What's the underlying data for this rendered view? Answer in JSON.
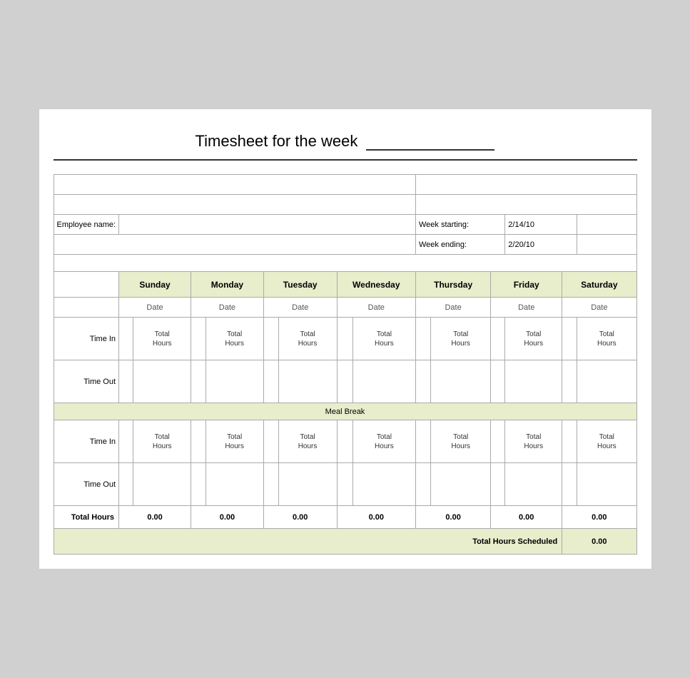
{
  "title": {
    "text": "Timesheet for the week",
    "underline": "_________________"
  },
  "employee": {
    "label": "Employee name:"
  },
  "week": {
    "starting_label": "Week starting:",
    "starting_value": "2/14/10",
    "ending_label": "Week ending:",
    "ending_value": "2/20/10"
  },
  "days": [
    "Sunday",
    "Monday",
    "Tuesday",
    "Wednesday",
    "Thursday",
    "Friday",
    "Saturday"
  ],
  "date_label": "Date",
  "time_in_label": "Time In",
  "time_out_label": "Time Out",
  "total_hours_label": "Total Hours",
  "hours_label": "Hours",
  "meal_break_label": "Meal Break",
  "total_hours_row_label": "Total Hours",
  "total_scheduled_label": "Total Hours Scheduled",
  "zero_value": "0.00",
  "total_hours_cells": [
    "Total\nHours",
    "Total\nHours",
    "Total\nHours",
    "Total\nHours",
    "Total\nHours",
    "Total\nHours",
    "Total\nHours"
  ]
}
